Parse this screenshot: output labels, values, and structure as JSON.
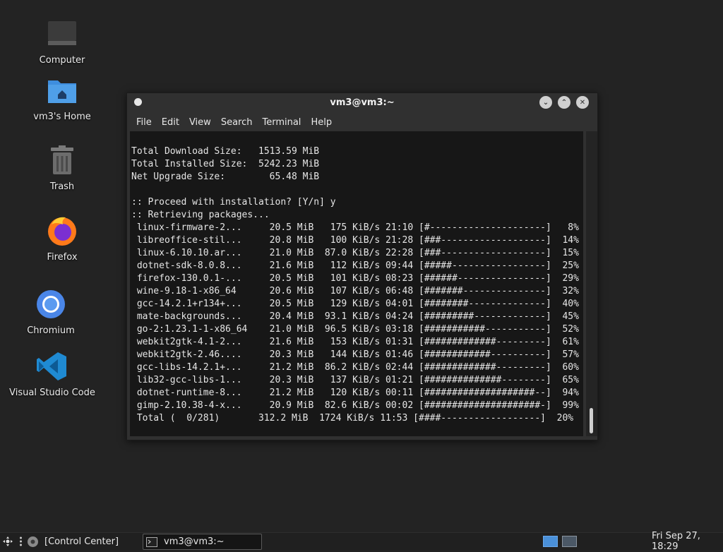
{
  "desktop": {
    "icons": [
      {
        "label": "Computer",
        "icon": "computer-icon"
      },
      {
        "label": "vm3's Home",
        "icon": "home-folder-icon"
      },
      {
        "label": "Trash",
        "icon": "trash-icon"
      },
      {
        "label": "Firefox",
        "icon": "firefox-icon"
      },
      {
        "label": "Chromium",
        "icon": "chromium-icon"
      },
      {
        "label": "Visual Studio Code",
        "icon": "vscode-icon"
      }
    ]
  },
  "window": {
    "title": "vm3@vm3:~",
    "menu": [
      "File",
      "Edit",
      "View",
      "Search",
      "Terminal",
      "Help"
    ],
    "terminal_lines": [
      "Total Download Size:   1513.59 MiB",
      "Total Installed Size:  5242.23 MiB",
      "Net Upgrade Size:        65.48 MiB",
      "",
      ":: Proceed with installation? [Y/n] y",
      ":: Retrieving packages...",
      " linux-firmware-2...     20.5 MiB   175 KiB/s 21:10 [#---------------------]   8%",
      " libreoffice-stil...     20.8 MiB   100 KiB/s 21:28 [###-------------------]  14%",
      " linux-6.10.10.ar...     21.0 MiB  87.0 KiB/s 22:28 [###-------------------]  15%",
      " dotnet-sdk-8.0.8...     21.6 MiB   112 KiB/s 09:44 [#####-----------------]  25%",
      " firefox-130.0.1-...     20.5 MiB   101 KiB/s 08:23 [######----------------]  29%",
      " wine-9.18-1-x86_64      20.6 MiB   107 KiB/s 06:48 [#######---------------]  32%",
      " gcc-14.2.1+r134+...     20.5 MiB   129 KiB/s 04:01 [########--------------]  40%",
      " mate-backgrounds...     20.4 MiB  93.1 KiB/s 04:24 [#########-------------]  45%",
      " go-2:1.23.1-1-x86_64    21.0 MiB  96.5 KiB/s 03:18 [###########-----------]  52%",
      " webkit2gtk-4.1-2...     21.6 MiB   153 KiB/s 01:31 [#############---------]  61%",
      " webkit2gtk-2.46....     20.3 MiB   144 KiB/s 01:46 [############----------]  57%",
      " gcc-libs-14.2.1+...     21.2 MiB  86.2 KiB/s 02:44 [#############---------]  60%",
      " lib32-gcc-libs-1...     20.3 MiB   137 KiB/s 01:21 [##############--------]  65%",
      " dotnet-runtime-8...     21.2 MiB   120 KiB/s 00:11 [####################--]  94%",
      " gimp-2.10.38-4-x...     20.9 MiB  82.6 KiB/s 00:02 [#####################-]  99%",
      " Total (  0/281)       312.2 MiB  1724 KiB/s 11:53 [####------------------]  20%"
    ]
  },
  "taskbar": {
    "control_center": "[Control Center]",
    "task_title": "vm3@vm3:~",
    "clock": "Fri Sep 27, 18:29"
  },
  "colors": {
    "desktop_bg": "#232323",
    "terminal_bg": "#171717",
    "folder_blue": "#3e8ede",
    "vscode_blue": "#1f8ad2",
    "workspace_active": "#4a90d9"
  }
}
